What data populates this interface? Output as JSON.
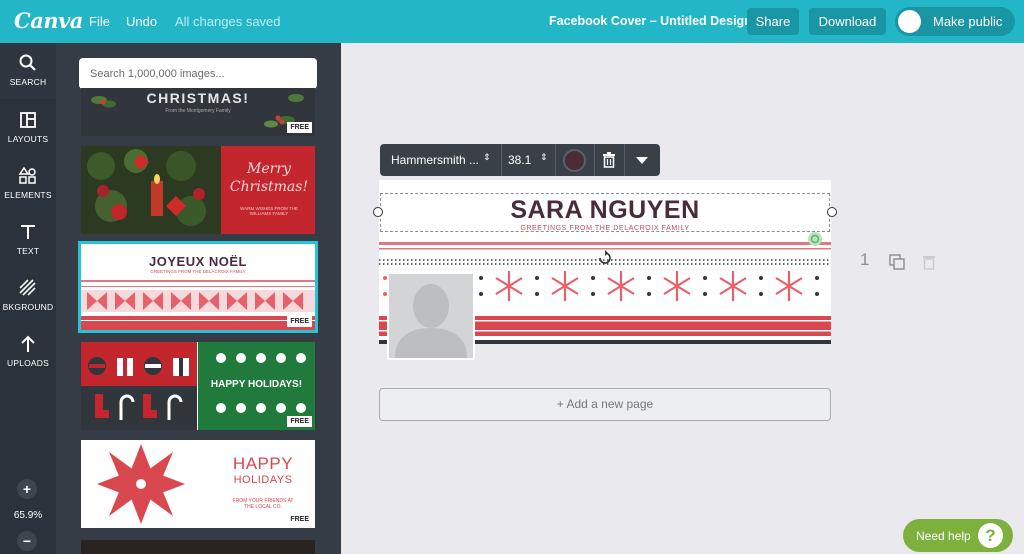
{
  "app": {
    "logo": "Canva",
    "menu": {
      "file": "File",
      "undo": "Undo",
      "saved_status": "All changes saved"
    },
    "doc_title": "Facebook Cover – Untitled Design",
    "share_label": "Share",
    "download_label": "Download",
    "make_public_label": "Make public"
  },
  "rail": {
    "items": [
      {
        "label": "SEARCH",
        "icon": "search-icon"
      },
      {
        "label": "LAYOUTS",
        "icon": "layouts-icon"
      },
      {
        "label": "ELEMENTS",
        "icon": "elements-icon"
      },
      {
        "label": "TEXT",
        "icon": "text-icon"
      },
      {
        "label": "BKGROUND",
        "icon": "background-icon"
      },
      {
        "label": "UPLOADS",
        "icon": "upload-icon"
      }
    ],
    "zoom_in": "+",
    "zoom_out": "−",
    "zoom_level": "65.9%"
  },
  "panel": {
    "search_placeholder": "Search 1,000,000 images...",
    "templates": [
      {
        "title": "CHRISTMAS!",
        "subtitle": "From the Montgomery Family",
        "badge": "FREE"
      },
      {
        "title": "Merry Christmas!",
        "subtitle": "WARM WISHES FROM THE WILLIAMS FAMILY",
        "badge": "FREE"
      },
      {
        "title": "JOYEUX NOËL",
        "subtitle": "GREETINGS FROM THE DELACROIX FAMILY",
        "badge": "FREE"
      },
      {
        "title": "HAPPY HOLIDAYS!",
        "subtitle": "",
        "badge": "FREE"
      },
      {
        "title": "HAPPY",
        "title2": "HOLIDAYS",
        "subtitle": "FROM YOUR FRIENDS AT THE LOCAL CO.",
        "badge": "FREE"
      }
    ]
  },
  "toolbar": {
    "font": "Hammersmith ...",
    "size": "38.1",
    "text_color": "#4b2b34"
  },
  "design": {
    "name": "SARA NGUYEN",
    "greeting": "GREETINGS FROM THE DELACROIX FAMILY"
  },
  "add_page_label": "+ Add a new page",
  "page_number": "1",
  "help_label": "Need help",
  "help_icon": "?",
  "colors": {
    "brand": "#22b6c6",
    "rail": "#2b323c",
    "panel": "#353c46",
    "accent_red": "#d9474f",
    "help": "#7db03c"
  }
}
